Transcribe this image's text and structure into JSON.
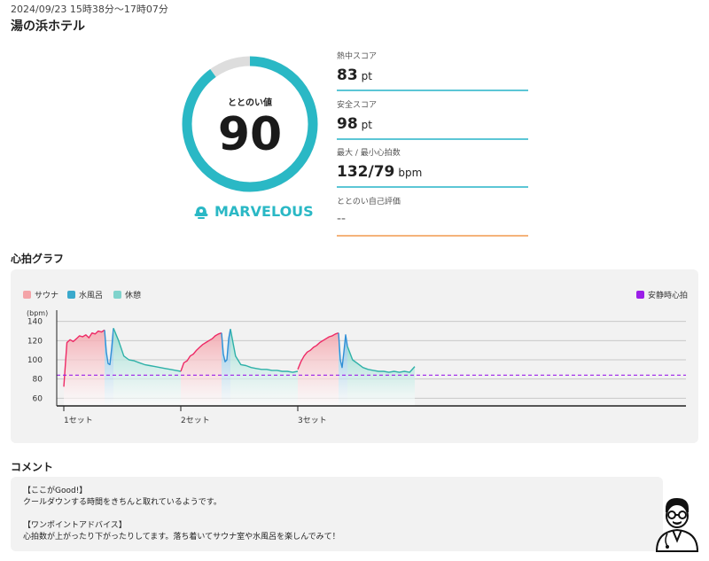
{
  "header": {
    "datetime": "2024/09/23 15時38分～17時07分",
    "place": "湯の浜ホテル"
  },
  "score": {
    "label": "ととのい値",
    "value": "90",
    "value_fraction": 0.9,
    "rating": "MARVELOUS",
    "accent_color": "#2ab8c5"
  },
  "stats": [
    {
      "label": "熱中スコア",
      "value": "83",
      "unit": "pt"
    },
    {
      "label": "安全スコア",
      "value": "98",
      "unit": "pt"
    },
    {
      "label": "最大 / 最小心拍数",
      "value": "132/79",
      "unit": "bpm"
    },
    {
      "label": "ととのい自己評価",
      "value": "--",
      "unit": ""
    }
  ],
  "chart_section": {
    "title": "心拍グラフ"
  },
  "chart_data": {
    "type": "area",
    "ylabel": "(bpm)",
    "yticks": [
      140,
      120,
      100,
      80,
      60
    ],
    "ylim": [
      52,
      148
    ],
    "x_labels": [
      "1セット",
      "2セット",
      "3セット"
    ],
    "legend": [
      {
        "name": "サウナ",
        "color": "#f4a4a8"
      },
      {
        "name": "水風呂",
        "color": "#3aa9cc"
      },
      {
        "name": "休憩",
        "color": "#7fd3cc"
      }
    ],
    "resting_hr": {
      "name": "安静時心拍",
      "value": 84,
      "color": "#9b1fe8"
    },
    "segments": [
      {
        "phase": "sauna",
        "points": [
          72,
          118,
          121,
          119,
          122,
          125,
          124,
          126,
          123,
          128,
          127,
          130,
          129,
          131
        ]
      },
      {
        "phase": "cold",
        "points": [
          131,
          108,
          96,
          95,
          112,
          133
        ]
      },
      {
        "phase": "rest",
        "points": [
          133,
          120,
          104,
          100,
          99,
          97,
          95,
          94,
          93,
          92,
          91,
          90,
          89,
          88
        ]
      },
      {
        "phase": "sauna",
        "points": [
          88,
          97,
          99,
          104,
          106,
          110,
          113,
          116,
          118,
          120,
          122,
          125,
          127,
          128
        ]
      },
      {
        "phase": "cold",
        "points": [
          128,
          106,
          98,
          100,
          122,
          132
        ]
      },
      {
        "phase": "rest",
        "points": [
          132,
          104,
          95,
          94,
          92,
          91,
          90,
          90,
          89,
          89,
          88,
          88,
          87,
          88
        ]
      },
      {
        "phase": "sauna",
        "points": [
          90,
          98,
          104,
          108,
          110,
          113,
          115,
          118,
          120,
          122,
          124,
          125,
          127,
          128
        ]
      },
      {
        "phase": "cold",
        "points": [
          128,
          100,
          92,
          108,
          126,
          114
        ]
      },
      {
        "phase": "rest",
        "points": [
          114,
          100,
          96,
          92,
          90,
          89,
          88,
          88,
          87,
          88,
          87,
          88,
          87,
          93
        ]
      }
    ]
  },
  "comment_section": {
    "title": "コメント",
    "good_heading": "【ここがGood!】",
    "good_text": "クールダウンする時間をきちんと取れているようです。",
    "advice_heading": "【ワンポイントアドバイス】",
    "advice_text": "心拍数が上がったり下がったりしてます。落ち着いてサウナ室や水風呂を楽しんでみて！"
  }
}
